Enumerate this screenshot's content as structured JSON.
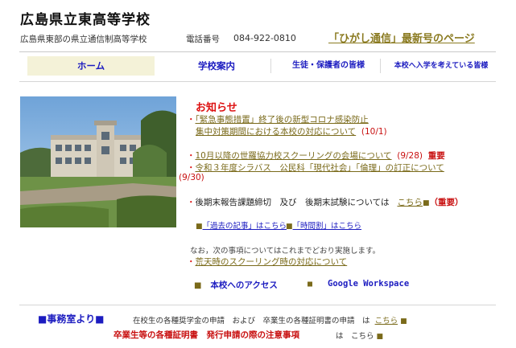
{
  "header": {
    "school_name": "広島県立東高等学校",
    "subtitle": "広島県東部の県立通信制高等学校",
    "phone_label": "電話番号",
    "phone_number": "084-922-0810",
    "newsletter_link": "「ひがし通信」最新号のページ"
  },
  "nav": {
    "items": [
      {
        "label": "ホーム"
      },
      {
        "label": "学校案内"
      },
      {
        "label": "生徒・保護者の皆様"
      },
      {
        "label": "本校へ入学を考えている皆様"
      }
    ]
  },
  "news": {
    "title": "お知らせ",
    "item1_line1": "「緊急事態措置」終了後の新型コロナ感染防止",
    "item1_line2": "集中対策期間における本校の対応について",
    "item1_date": "(10/1)",
    "item2_text": "10月以降の世羅協力校スクーリングの会場について",
    "item2_date": "(9/28)",
    "item2_badge": "重要",
    "item3_text": "令和３年度シラバス　公民科「現代社会」「倫理」の訂正について",
    "item3_date": "(9/30)",
    "item4_text": "後期末報告課題締切　及び　後期末試験については",
    "item4_link": "こちら",
    "item4_badge": "（重要）",
    "past_articles": "「過去の記事」はこちら",
    "timetable": "「時間割」はこちら",
    "note": "なお，次の事項についてはこれまでどおり実施します。",
    "storm_link": "荒天時のスクーリング時の対応について"
  },
  "links": {
    "access": "本校へのアクセス",
    "google": "Google Workspace"
  },
  "office": {
    "heading": "■事務室より■",
    "text": "在校生の各種奨学金の申請　および　卒業生の各種証明書の申請　は",
    "link": "こちら",
    "red_line": "卒業生等の各種証明書　発行申請の際の注意事項",
    "red_tail": "は　こちら"
  }
}
